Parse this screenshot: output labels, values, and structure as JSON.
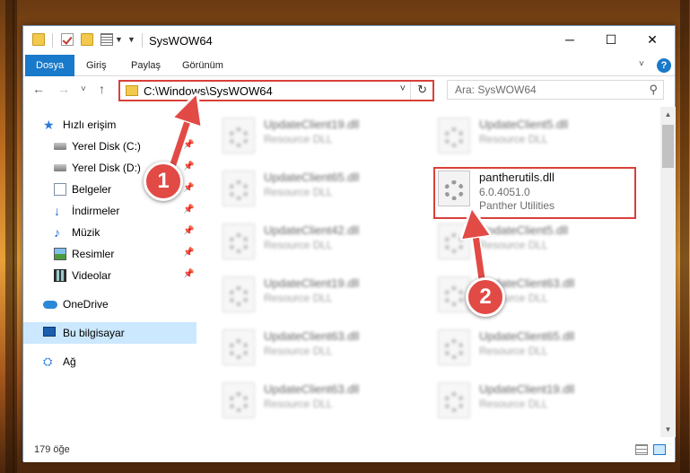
{
  "window": {
    "title": "SysWOW64",
    "controls": {
      "minimize": "─",
      "maximize": "☐",
      "close": "✕"
    }
  },
  "ribbon": {
    "tabs": [
      {
        "label": "Dosya",
        "active": true
      },
      {
        "label": "Giriş",
        "active": false
      },
      {
        "label": "Paylaş",
        "active": false
      },
      {
        "label": "Görünüm",
        "active": false
      }
    ],
    "help": "?"
  },
  "navbar": {
    "address": "C:\\Windows\\SysWOW64",
    "search_placeholder": "Ara: SysWOW64"
  },
  "sidebar": {
    "items": [
      {
        "label": "Hızlı erişim",
        "icon": "star-icon"
      },
      {
        "label": "Yerel Disk (C:)",
        "icon": "drive-icon",
        "pinned": true
      },
      {
        "label": "Yerel Disk (D:)",
        "icon": "drive-icon",
        "pinned": true
      },
      {
        "label": "Belgeler",
        "icon": "documents-icon",
        "pinned": true
      },
      {
        "label": "İndirmeler",
        "icon": "download-icon",
        "pinned": true
      },
      {
        "label": "Müzik",
        "icon": "music-icon",
        "pinned": true
      },
      {
        "label": "Resimler",
        "icon": "pictures-icon",
        "pinned": true
      },
      {
        "label": "Videolar",
        "icon": "videos-icon",
        "pinned": true
      },
      {
        "label": "OneDrive",
        "icon": "onedrive-icon"
      },
      {
        "label": "Bu bilgisayar",
        "icon": "this-pc-icon",
        "selected": true
      },
      {
        "label": "Ağ",
        "icon": "network-icon"
      }
    ]
  },
  "files": [
    {
      "name": "UpdateClient19.dll",
      "desc": "Resource DLL"
    },
    {
      "name": "UpdateClient5.dll",
      "desc": "Resource DLL"
    },
    {
      "name": "UpdateClient65.dll",
      "desc": "Resource DLL"
    },
    {
      "name": "pantherutils.dll",
      "version": "6.0.4051.0",
      "company": "Panther Utilities"
    },
    {
      "name": "UpdateClient42.dll",
      "desc": "Resource DLL"
    },
    {
      "name": "UpdateClient5.dll",
      "desc": "Resource DLL"
    },
    {
      "name": "UpdateClient19.dll",
      "desc": "Resource DLL"
    },
    {
      "name": "UpdateClient63.dll",
      "desc": "Resource DLL"
    },
    {
      "name": "UpdateClient63.dll",
      "desc": "Resource DLL"
    },
    {
      "name": "UpdateClient65.dll",
      "desc": "Resource DLL"
    },
    {
      "name": "UpdateClient63.dll",
      "desc": "Resource DLL"
    },
    {
      "name": "UpdateClient19.dll",
      "desc": "Resource DLL"
    }
  ],
  "status": {
    "count": "179 öğe"
  },
  "annotations": {
    "marker1": "1",
    "marker2": "2",
    "color": "#e24a45"
  }
}
